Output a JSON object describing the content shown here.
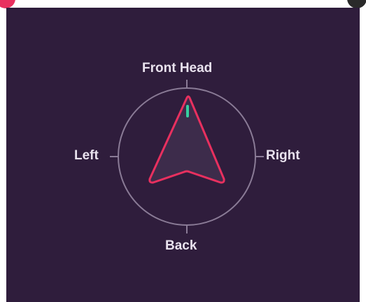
{
  "compass": {
    "labels": {
      "front": "Front Head",
      "left": "Left",
      "right": "Right",
      "back": "Back"
    },
    "colors": {
      "background": "#2f1d3c",
      "ring": "#8a7b96",
      "arrow_stroke": "#e8305f",
      "arrow_fill": "#3d2c4b",
      "indicator": "#36d1a0",
      "label": "#e9e2ee",
      "accent_dot": "#e8305f"
    },
    "arrow_icon": "direction-arrow-icon",
    "indicator_icon": "orientation-marker-icon"
  }
}
